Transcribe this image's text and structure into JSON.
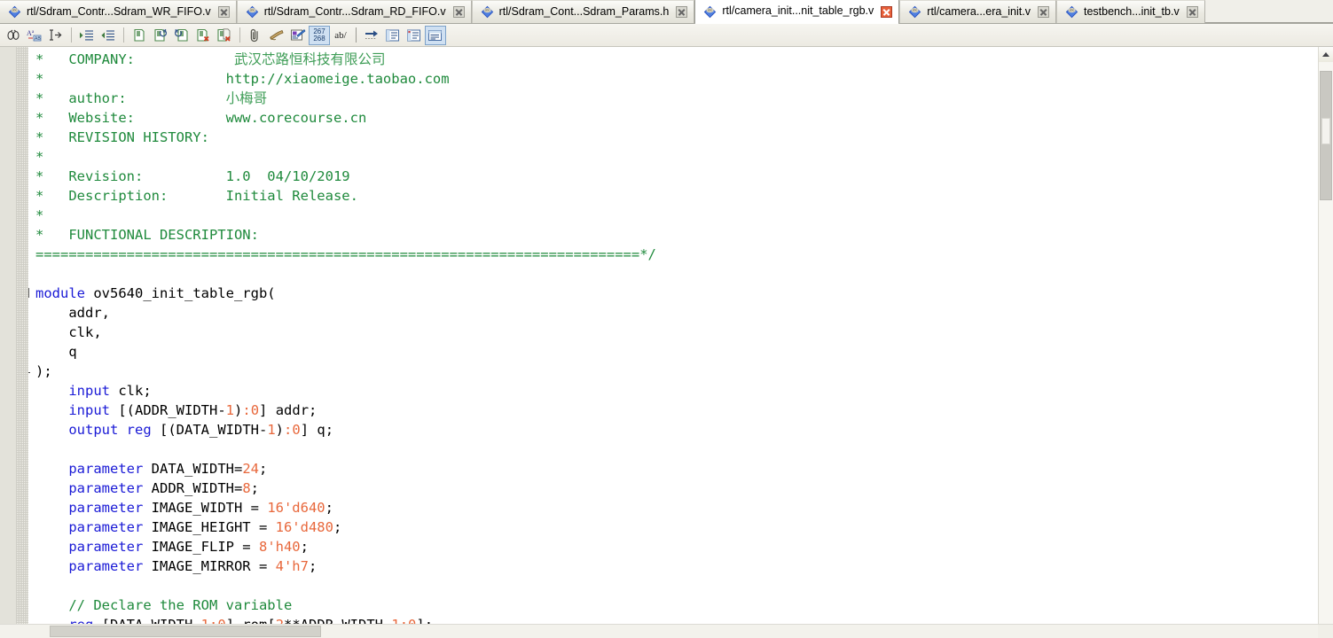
{
  "tabs": [
    {
      "label": "rtl/Sdram_Contr...Sdram_WR_FIFO.v",
      "active": false,
      "icon": "verilog-file-icon"
    },
    {
      "label": "rtl/Sdram_Contr...Sdram_RD_FIFO.v",
      "active": false,
      "icon": "verilog-file-icon"
    },
    {
      "label": "rtl/Sdram_Cont...Sdram_Params.h",
      "active": false,
      "icon": "verilog-file-icon"
    },
    {
      "label": "rtl/camera_init...nit_table_rgb.v",
      "active": true,
      "icon": "verilog-file-icon"
    },
    {
      "label": "rtl/camera...era_init.v",
      "active": false,
      "icon": "verilog-file-icon"
    },
    {
      "label": "testbench...init_tb.v",
      "active": false,
      "icon": "verilog-file-icon"
    }
  ],
  "toolbar": {
    "buttons": [
      {
        "name": "find-icon",
        "glyph": "find",
        "active": false
      },
      {
        "name": "find-replace-icon",
        "glyph": "replace",
        "active": false
      },
      {
        "name": "goto-line-icon",
        "glyph": "goto",
        "active": false
      },
      {
        "name": "separator",
        "glyph": "sep",
        "active": false
      },
      {
        "name": "increase-indent-icon",
        "glyph": "indent-in",
        "active": false
      },
      {
        "name": "decrease-indent-icon",
        "glyph": "indent-out",
        "active": false
      },
      {
        "name": "separator",
        "glyph": "sep",
        "active": false
      },
      {
        "name": "open-file-icon",
        "glyph": "doc",
        "active": false
      },
      {
        "name": "reload-file-icon",
        "glyph": "doc-reload",
        "active": false
      },
      {
        "name": "undo-file-icon",
        "glyph": "doc-undo",
        "active": false
      },
      {
        "name": "close-file-icon",
        "glyph": "doc-x",
        "active": false
      },
      {
        "name": "close-all-files-icon",
        "glyph": "docs-x",
        "active": false
      },
      {
        "name": "separator",
        "glyph": "sep",
        "active": false
      },
      {
        "name": "attach-icon",
        "glyph": "clip",
        "active": false
      },
      {
        "name": "scroll-document-icon",
        "glyph": "scroll",
        "active": false
      },
      {
        "name": "color-settings-icon",
        "glyph": "palette",
        "active": false
      },
      {
        "name": "line-numbers-icon",
        "glyph": "linenum",
        "active": true
      },
      {
        "name": "word-wrap-icon",
        "glyph": "abwrap",
        "active": false
      },
      {
        "name": "separator",
        "glyph": "sep-plain",
        "active": false
      },
      {
        "name": "goto-next-icon",
        "glyph": "arrow-right",
        "active": false
      },
      {
        "name": "show-whitespace-icon",
        "glyph": "panel-a",
        "active": false
      },
      {
        "name": "show-indent-guide-icon",
        "glyph": "panel-b",
        "active": false
      },
      {
        "name": "comment-block-icon",
        "glyph": "panel-c",
        "active": true
      }
    ],
    "line_number_label_top": "267",
    "line_number_label_bottom": "268",
    "wrap_label": "ab/"
  },
  "code": {
    "lines": [
      {
        "tokens": [
          {
            "t": "*   COMPANY:            ",
            "c": "com"
          },
          {
            "t": "武汉芯路恒科技有限公司",
            "c": "cjk"
          }
        ]
      },
      {
        "tokens": [
          {
            "t": "*                      http://xiaomeige.taobao.com",
            "c": "com"
          }
        ]
      },
      {
        "tokens": [
          {
            "t": "*   author:            ",
            "c": "com"
          },
          {
            "t": "小梅哥",
            "c": "cjk"
          }
        ]
      },
      {
        "tokens": [
          {
            "t": "*   Website:           www.corecourse.cn",
            "c": "com"
          }
        ]
      },
      {
        "tokens": [
          {
            "t": "*   REVISION HISTORY:",
            "c": "com"
          }
        ]
      },
      {
        "tokens": [
          {
            "t": "*",
            "c": "com"
          }
        ]
      },
      {
        "tokens": [
          {
            "t": "*   Revision:          1.0  04/10/2019",
            "c": "com"
          }
        ]
      },
      {
        "tokens": [
          {
            "t": "*   Description:       Initial Release.",
            "c": "com"
          }
        ]
      },
      {
        "tokens": [
          {
            "t": "*",
            "c": "com"
          }
        ]
      },
      {
        "tokens": [
          {
            "t": "*   FUNCTIONAL DESCRIPTION:",
            "c": "com"
          }
        ]
      },
      {
        "tokens": [
          {
            "t": "=========================================================================*/",
            "c": "com"
          }
        ]
      },
      {
        "tokens": [
          {
            "t": "",
            "c": "txt"
          }
        ]
      },
      {
        "tokens": [
          {
            "t": "module",
            "c": "kw"
          },
          {
            "t": " ov5640_init_table_rgb(",
            "c": "txt"
          }
        ],
        "fold": "start"
      },
      {
        "tokens": [
          {
            "t": "    addr,",
            "c": "txt"
          }
        ]
      },
      {
        "tokens": [
          {
            "t": "    clk,",
            "c": "txt"
          }
        ]
      },
      {
        "tokens": [
          {
            "t": "    q",
            "c": "txt"
          }
        ]
      },
      {
        "tokens": [
          {
            "t": ");",
            "c": "txt"
          }
        ],
        "fold": "end"
      },
      {
        "tokens": [
          {
            "t": "    ",
            "c": "txt"
          },
          {
            "t": "input",
            "c": "kw"
          },
          {
            "t": " clk;",
            "c": "txt"
          }
        ]
      },
      {
        "tokens": [
          {
            "t": "    ",
            "c": "txt"
          },
          {
            "t": "input",
            "c": "kw"
          },
          {
            "t": " [(ADDR_WIDTH-",
            "c": "txt"
          },
          {
            "t": "1",
            "c": "num"
          },
          {
            "t": ")",
            "c": "txt"
          },
          {
            "t": ":",
            "c": "num"
          },
          {
            "t": "0",
            "c": "num"
          },
          {
            "t": "] addr;",
            "c": "txt"
          }
        ]
      },
      {
        "tokens": [
          {
            "t": "    ",
            "c": "txt"
          },
          {
            "t": "output",
            "c": "kw"
          },
          {
            "t": " ",
            "c": "txt"
          },
          {
            "t": "reg",
            "c": "kw"
          },
          {
            "t": " [(DATA_WIDTH-",
            "c": "txt"
          },
          {
            "t": "1",
            "c": "num"
          },
          {
            "t": ")",
            "c": "txt"
          },
          {
            "t": ":",
            "c": "num"
          },
          {
            "t": "0",
            "c": "num"
          },
          {
            "t": "] q;",
            "c": "txt"
          }
        ]
      },
      {
        "tokens": [
          {
            "t": "",
            "c": "txt"
          }
        ]
      },
      {
        "tokens": [
          {
            "t": "    ",
            "c": "txt"
          },
          {
            "t": "parameter",
            "c": "kw"
          },
          {
            "t": " DATA_WIDTH=",
            "c": "txt"
          },
          {
            "t": "24",
            "c": "num"
          },
          {
            "t": ";",
            "c": "txt"
          }
        ]
      },
      {
        "tokens": [
          {
            "t": "    ",
            "c": "txt"
          },
          {
            "t": "parameter",
            "c": "kw"
          },
          {
            "t": " ADDR_WIDTH=",
            "c": "txt"
          },
          {
            "t": "8",
            "c": "num"
          },
          {
            "t": ";",
            "c": "txt"
          }
        ]
      },
      {
        "tokens": [
          {
            "t": "    ",
            "c": "txt"
          },
          {
            "t": "parameter",
            "c": "kw"
          },
          {
            "t": " IMAGE_WIDTH = ",
            "c": "txt"
          },
          {
            "t": "16'd640",
            "c": "num"
          },
          {
            "t": ";",
            "c": "txt"
          }
        ]
      },
      {
        "tokens": [
          {
            "t": "    ",
            "c": "txt"
          },
          {
            "t": "parameter",
            "c": "kw"
          },
          {
            "t": " IMAGE_HEIGHT = ",
            "c": "txt"
          },
          {
            "t": "16'd480",
            "c": "num"
          },
          {
            "t": ";",
            "c": "txt"
          }
        ]
      },
      {
        "tokens": [
          {
            "t": "    ",
            "c": "txt"
          },
          {
            "t": "parameter",
            "c": "kw"
          },
          {
            "t": " IMAGE_FLIP = ",
            "c": "txt"
          },
          {
            "t": "8'h40",
            "c": "num"
          },
          {
            "t": ";",
            "c": "txt"
          }
        ]
      },
      {
        "tokens": [
          {
            "t": "    ",
            "c": "txt"
          },
          {
            "t": "parameter",
            "c": "kw"
          },
          {
            "t": " IMAGE_MIRROR = ",
            "c": "txt"
          },
          {
            "t": "4'h7",
            "c": "num"
          },
          {
            "t": ";",
            "c": "txt"
          }
        ]
      },
      {
        "tokens": [
          {
            "t": "",
            "c": "txt"
          }
        ]
      },
      {
        "tokens": [
          {
            "t": "    ",
            "c": "txt"
          },
          {
            "t": "// Declare the ROM variable",
            "c": "com"
          }
        ]
      },
      {
        "tokens": [
          {
            "t": "    ",
            "c": "txt"
          },
          {
            "t": "reg",
            "c": "kw"
          },
          {
            "t": " [DATA_WIDTH-",
            "c": "txt"
          },
          {
            "t": "1",
            "c": "num"
          },
          {
            "t": ":",
            "c": "num"
          },
          {
            "t": "0",
            "c": "num"
          },
          {
            "t": "] rom[",
            "c": "txt"
          },
          {
            "t": "2",
            "c": "num"
          },
          {
            "t": "**ADDR_WIDTH-",
            "c": "txt"
          },
          {
            "t": "1",
            "c": "num"
          },
          {
            "t": ":",
            "c": "num"
          },
          {
            "t": "0",
            "c": "num"
          },
          {
            "t": "];",
            "c": "txt"
          }
        ]
      }
    ]
  },
  "colors": {
    "comment": "#1f8a3c",
    "keyword": "#1a1ad6",
    "number": "#e8683c",
    "text": "#000000",
    "cjk": "#3f9d57",
    "editor_bg": "#ffffff",
    "chrome_bg": "#f0efe9",
    "active_tab_close": "#e8603a",
    "toolbar_active": "#cfe0f2"
  },
  "scrollbars": {
    "vertical_position_label": "",
    "horizontal_position_label": ""
  }
}
